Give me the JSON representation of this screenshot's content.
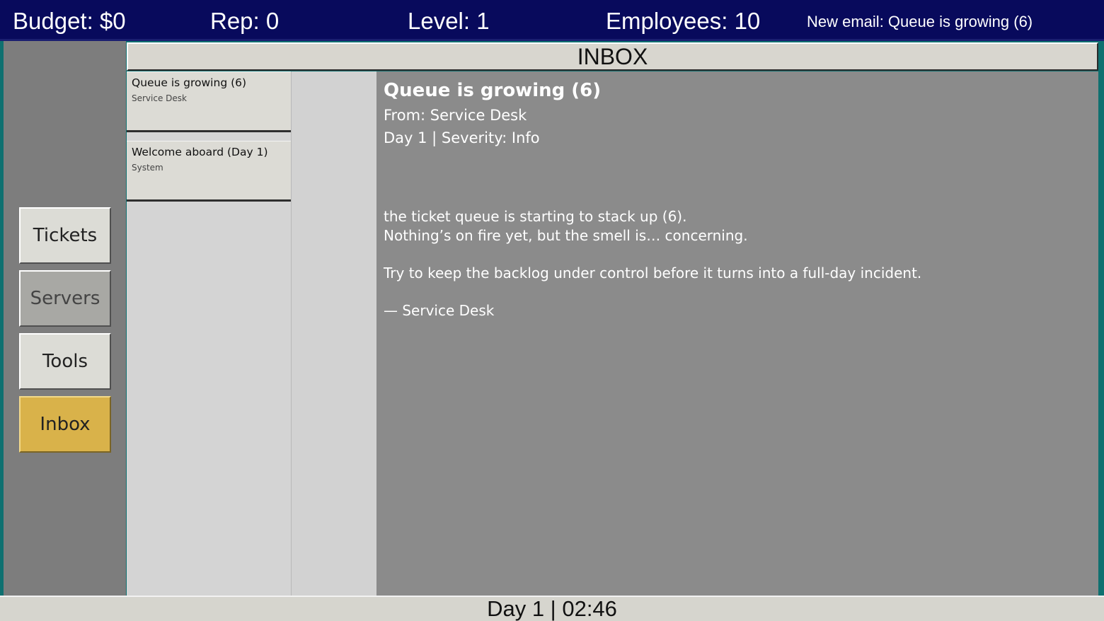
{
  "topbar": {
    "budget": "Budget: $0",
    "rep": "Rep: 0",
    "level": "Level: 1",
    "employees": "Employees: 10",
    "notice": "New email: Queue is growing (6)"
  },
  "nav": {
    "items": [
      {
        "label": "Tickets"
      },
      {
        "label": "Servers"
      },
      {
        "label": "Tools"
      },
      {
        "label": "Inbox"
      }
    ],
    "active_color": "#d9b24a"
  },
  "inbox": {
    "title": "INBOX",
    "emails": [
      {
        "subject": "Queue is growing (6)",
        "sender": "Service Desk"
      },
      {
        "subject": "Welcome aboard (Day 1)",
        "sender": "System"
      }
    ]
  },
  "message": {
    "subject": "Queue is growing (6)",
    "from": "From: Service Desk",
    "meta": "Day 1  |  Severity: Info",
    "body": {
      "line1": "the ticket queue is starting to stack up (6).",
      "line2": "Nothing’s on fire yet, but the smell is… concerning.",
      "line3": "Try to keep the backlog under control before it turns into a full-day incident.",
      "signature": "— Service Desk"
    }
  },
  "status": {
    "clock": "Day 1 | 02:46"
  },
  "colors": {
    "topbar": "#080a5c",
    "background": "#0f7070",
    "message_pane": "#8b8b8b"
  }
}
